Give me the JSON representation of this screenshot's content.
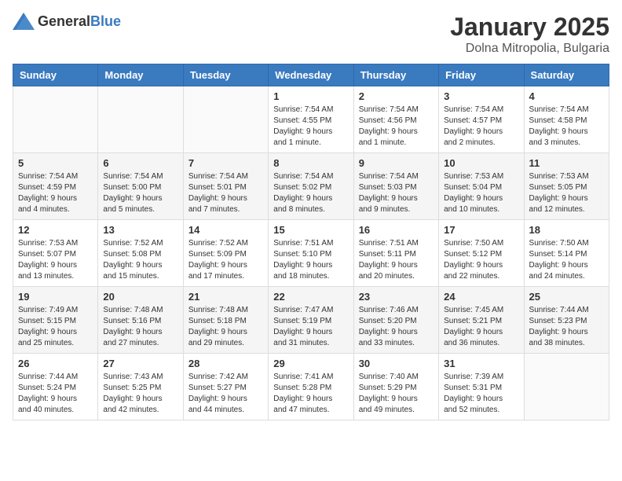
{
  "header": {
    "logo_general": "General",
    "logo_blue": "Blue",
    "title": "January 2025",
    "subtitle": "Dolna Mitropolia, Bulgaria"
  },
  "calendar": {
    "days_of_week": [
      "Sunday",
      "Monday",
      "Tuesday",
      "Wednesday",
      "Thursday",
      "Friday",
      "Saturday"
    ],
    "weeks": [
      [
        {
          "day": "",
          "info": ""
        },
        {
          "day": "",
          "info": ""
        },
        {
          "day": "",
          "info": ""
        },
        {
          "day": "1",
          "info": "Sunrise: 7:54 AM\nSunset: 4:55 PM\nDaylight: 9 hours\nand 1 minute."
        },
        {
          "day": "2",
          "info": "Sunrise: 7:54 AM\nSunset: 4:56 PM\nDaylight: 9 hours\nand 1 minute."
        },
        {
          "day": "3",
          "info": "Sunrise: 7:54 AM\nSunset: 4:57 PM\nDaylight: 9 hours\nand 2 minutes."
        },
        {
          "day": "4",
          "info": "Sunrise: 7:54 AM\nSunset: 4:58 PM\nDaylight: 9 hours\nand 3 minutes."
        }
      ],
      [
        {
          "day": "5",
          "info": "Sunrise: 7:54 AM\nSunset: 4:59 PM\nDaylight: 9 hours\nand 4 minutes."
        },
        {
          "day": "6",
          "info": "Sunrise: 7:54 AM\nSunset: 5:00 PM\nDaylight: 9 hours\nand 5 minutes."
        },
        {
          "day": "7",
          "info": "Sunrise: 7:54 AM\nSunset: 5:01 PM\nDaylight: 9 hours\nand 7 minutes."
        },
        {
          "day": "8",
          "info": "Sunrise: 7:54 AM\nSunset: 5:02 PM\nDaylight: 9 hours\nand 8 minutes."
        },
        {
          "day": "9",
          "info": "Sunrise: 7:54 AM\nSunset: 5:03 PM\nDaylight: 9 hours\nand 9 minutes."
        },
        {
          "day": "10",
          "info": "Sunrise: 7:53 AM\nSunset: 5:04 PM\nDaylight: 9 hours\nand 10 minutes."
        },
        {
          "day": "11",
          "info": "Sunrise: 7:53 AM\nSunset: 5:05 PM\nDaylight: 9 hours\nand 12 minutes."
        }
      ],
      [
        {
          "day": "12",
          "info": "Sunrise: 7:53 AM\nSunset: 5:07 PM\nDaylight: 9 hours\nand 13 minutes."
        },
        {
          "day": "13",
          "info": "Sunrise: 7:52 AM\nSunset: 5:08 PM\nDaylight: 9 hours\nand 15 minutes."
        },
        {
          "day": "14",
          "info": "Sunrise: 7:52 AM\nSunset: 5:09 PM\nDaylight: 9 hours\nand 17 minutes."
        },
        {
          "day": "15",
          "info": "Sunrise: 7:51 AM\nSunset: 5:10 PM\nDaylight: 9 hours\nand 18 minutes."
        },
        {
          "day": "16",
          "info": "Sunrise: 7:51 AM\nSunset: 5:11 PM\nDaylight: 9 hours\nand 20 minutes."
        },
        {
          "day": "17",
          "info": "Sunrise: 7:50 AM\nSunset: 5:12 PM\nDaylight: 9 hours\nand 22 minutes."
        },
        {
          "day": "18",
          "info": "Sunrise: 7:50 AM\nSunset: 5:14 PM\nDaylight: 9 hours\nand 24 minutes."
        }
      ],
      [
        {
          "day": "19",
          "info": "Sunrise: 7:49 AM\nSunset: 5:15 PM\nDaylight: 9 hours\nand 25 minutes."
        },
        {
          "day": "20",
          "info": "Sunrise: 7:48 AM\nSunset: 5:16 PM\nDaylight: 9 hours\nand 27 minutes."
        },
        {
          "day": "21",
          "info": "Sunrise: 7:48 AM\nSunset: 5:18 PM\nDaylight: 9 hours\nand 29 minutes."
        },
        {
          "day": "22",
          "info": "Sunrise: 7:47 AM\nSunset: 5:19 PM\nDaylight: 9 hours\nand 31 minutes."
        },
        {
          "day": "23",
          "info": "Sunrise: 7:46 AM\nSunset: 5:20 PM\nDaylight: 9 hours\nand 33 minutes."
        },
        {
          "day": "24",
          "info": "Sunrise: 7:45 AM\nSunset: 5:21 PM\nDaylight: 9 hours\nand 36 minutes."
        },
        {
          "day": "25",
          "info": "Sunrise: 7:44 AM\nSunset: 5:23 PM\nDaylight: 9 hours\nand 38 minutes."
        }
      ],
      [
        {
          "day": "26",
          "info": "Sunrise: 7:44 AM\nSunset: 5:24 PM\nDaylight: 9 hours\nand 40 minutes."
        },
        {
          "day": "27",
          "info": "Sunrise: 7:43 AM\nSunset: 5:25 PM\nDaylight: 9 hours\nand 42 minutes."
        },
        {
          "day": "28",
          "info": "Sunrise: 7:42 AM\nSunset: 5:27 PM\nDaylight: 9 hours\nand 44 minutes."
        },
        {
          "day": "29",
          "info": "Sunrise: 7:41 AM\nSunset: 5:28 PM\nDaylight: 9 hours\nand 47 minutes."
        },
        {
          "day": "30",
          "info": "Sunrise: 7:40 AM\nSunset: 5:29 PM\nDaylight: 9 hours\nand 49 minutes."
        },
        {
          "day": "31",
          "info": "Sunrise: 7:39 AM\nSunset: 5:31 PM\nDaylight: 9 hours\nand 52 minutes."
        },
        {
          "day": "",
          "info": ""
        }
      ]
    ]
  }
}
